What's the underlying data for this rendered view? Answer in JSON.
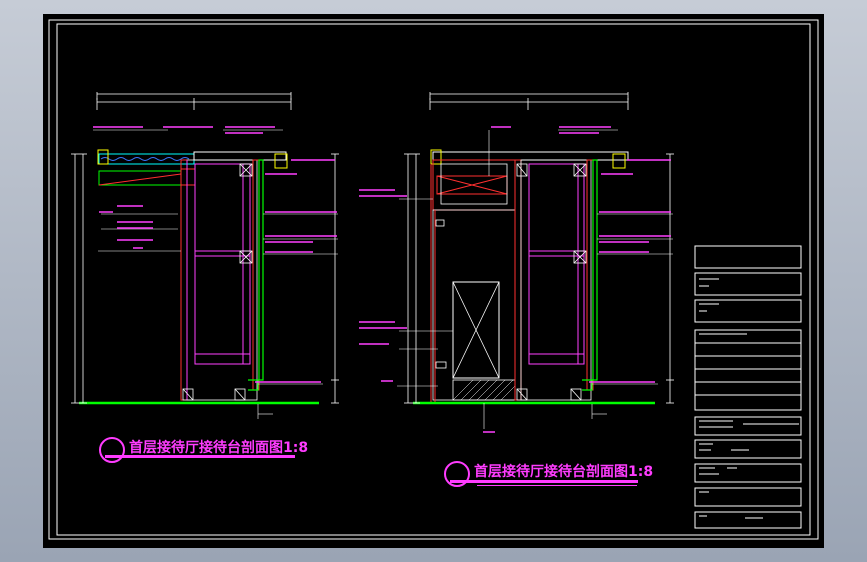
{
  "drawing": {
    "section_title_left": "首层接待厅接待台剖面图1:8",
    "section_title_right": "首层接待厅接待台剖面图1:8"
  },
  "colors": {
    "background": "#000000",
    "frame": "#ffffff",
    "dimension": "#ffffff",
    "text_annotation": "#ff40ff",
    "wall": "#ff3030",
    "panel": "#00ff00",
    "hatch": "#00ffff",
    "title": "#ff3cff",
    "viewport_chrome": "#b4bccb"
  }
}
